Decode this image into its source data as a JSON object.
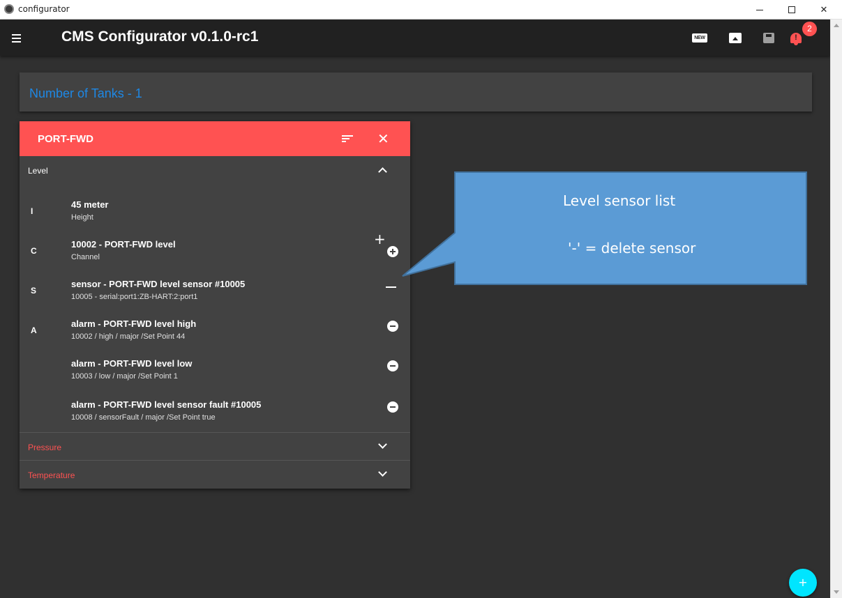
{
  "window": {
    "title": "configurator",
    "minimize_icon": "minimize-icon",
    "maximize_icon": "maximize-icon",
    "close_glyph": "✕"
  },
  "toolbar": {
    "title": "CMS Configurator v0.1.0-rc1",
    "new_label": "NEW",
    "bell_glyph": "!",
    "notification_count": "2"
  },
  "tanks": {
    "title": "Number of Tanks - 1"
  },
  "tank": {
    "name": "PORT-FWD",
    "close_glyph": "✕",
    "sections": {
      "level": "Level",
      "pressure": "Pressure",
      "temperature": "Temperature"
    },
    "rows": [
      {
        "letter": "I",
        "title": "45 meter",
        "subtitle": "Height"
      },
      {
        "letter": "C",
        "title": "10002 - PORT-FWD level",
        "subtitle": "Channel",
        "action": "+"
      },
      {
        "letter": "S",
        "title": "sensor - PORT-FWD level sensor #10005",
        "subtitle": "10005 - serial:port1:ZB-HART:2:port1"
      },
      {
        "letter": "A",
        "title": "alarm - PORT-FWD level high",
        "subtitle": "10002 / high / major /Set Point  44"
      },
      {
        "letter": "",
        "title": "alarm - PORT-FWD level low",
        "subtitle": "10003 / low / major /Set Point  1"
      },
      {
        "letter": "",
        "title": "alarm - PORT-FWD level sensor fault #10005",
        "subtitle": "10008 / sensorFault / major /Set Point  true"
      }
    ]
  },
  "fab": {
    "label": "+"
  },
  "callout": {
    "line1": "Level sensor list",
    "line2": "'-' = delete sensor",
    "fill": "#5b9bd5",
    "stroke": "#41719c"
  },
  "colors": {
    "toolbar": "#212121",
    "background": "#303030",
    "card": "#424242",
    "accent_red": "#ff5252",
    "tanks_title": "#1e88e5",
    "fab": "#00e5ff"
  }
}
